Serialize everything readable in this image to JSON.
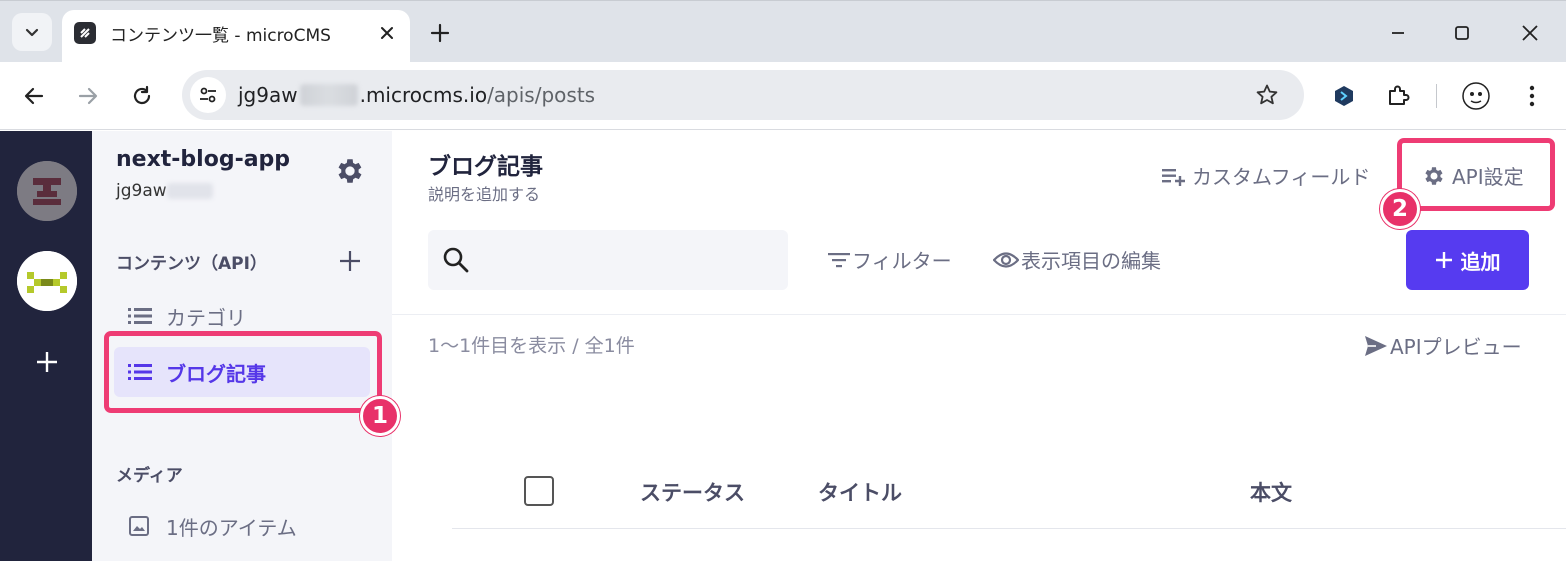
{
  "browser": {
    "tab_title": "コンテンツ一覧 - microCMS",
    "url_prefix": "jg9aw",
    "url_domain": ".microcms.io",
    "url_path": "/apis/posts"
  },
  "sidebar": {
    "service_name": "next-blog-app",
    "service_id": "jg9aw",
    "contents_section": "コンテンツ（API）",
    "items": [
      {
        "label": "カテゴリ",
        "icon": "list-icon"
      },
      {
        "label": "ブログ記事",
        "icon": "list-icon",
        "active": true
      }
    ],
    "media_section": "メディア",
    "media_item": "1件のアイテム"
  },
  "main": {
    "title": "ブログ記事",
    "description": "説明を追加する",
    "custom_field": "カスタムフィールド",
    "api_settings": "API設定",
    "filter": "フィルター",
    "view_edit": "表示項目の編集",
    "add_button": "追加",
    "count_text": "1〜1件目を表示 / 全1件",
    "api_preview": "APIプレビュー",
    "columns": [
      "ステータス",
      "タイトル",
      "本文"
    ]
  },
  "annotations": [
    "1",
    "2"
  ],
  "colors": {
    "accent": "#563bf0",
    "highlight": "#ee3c74",
    "rail": "#21243d"
  }
}
